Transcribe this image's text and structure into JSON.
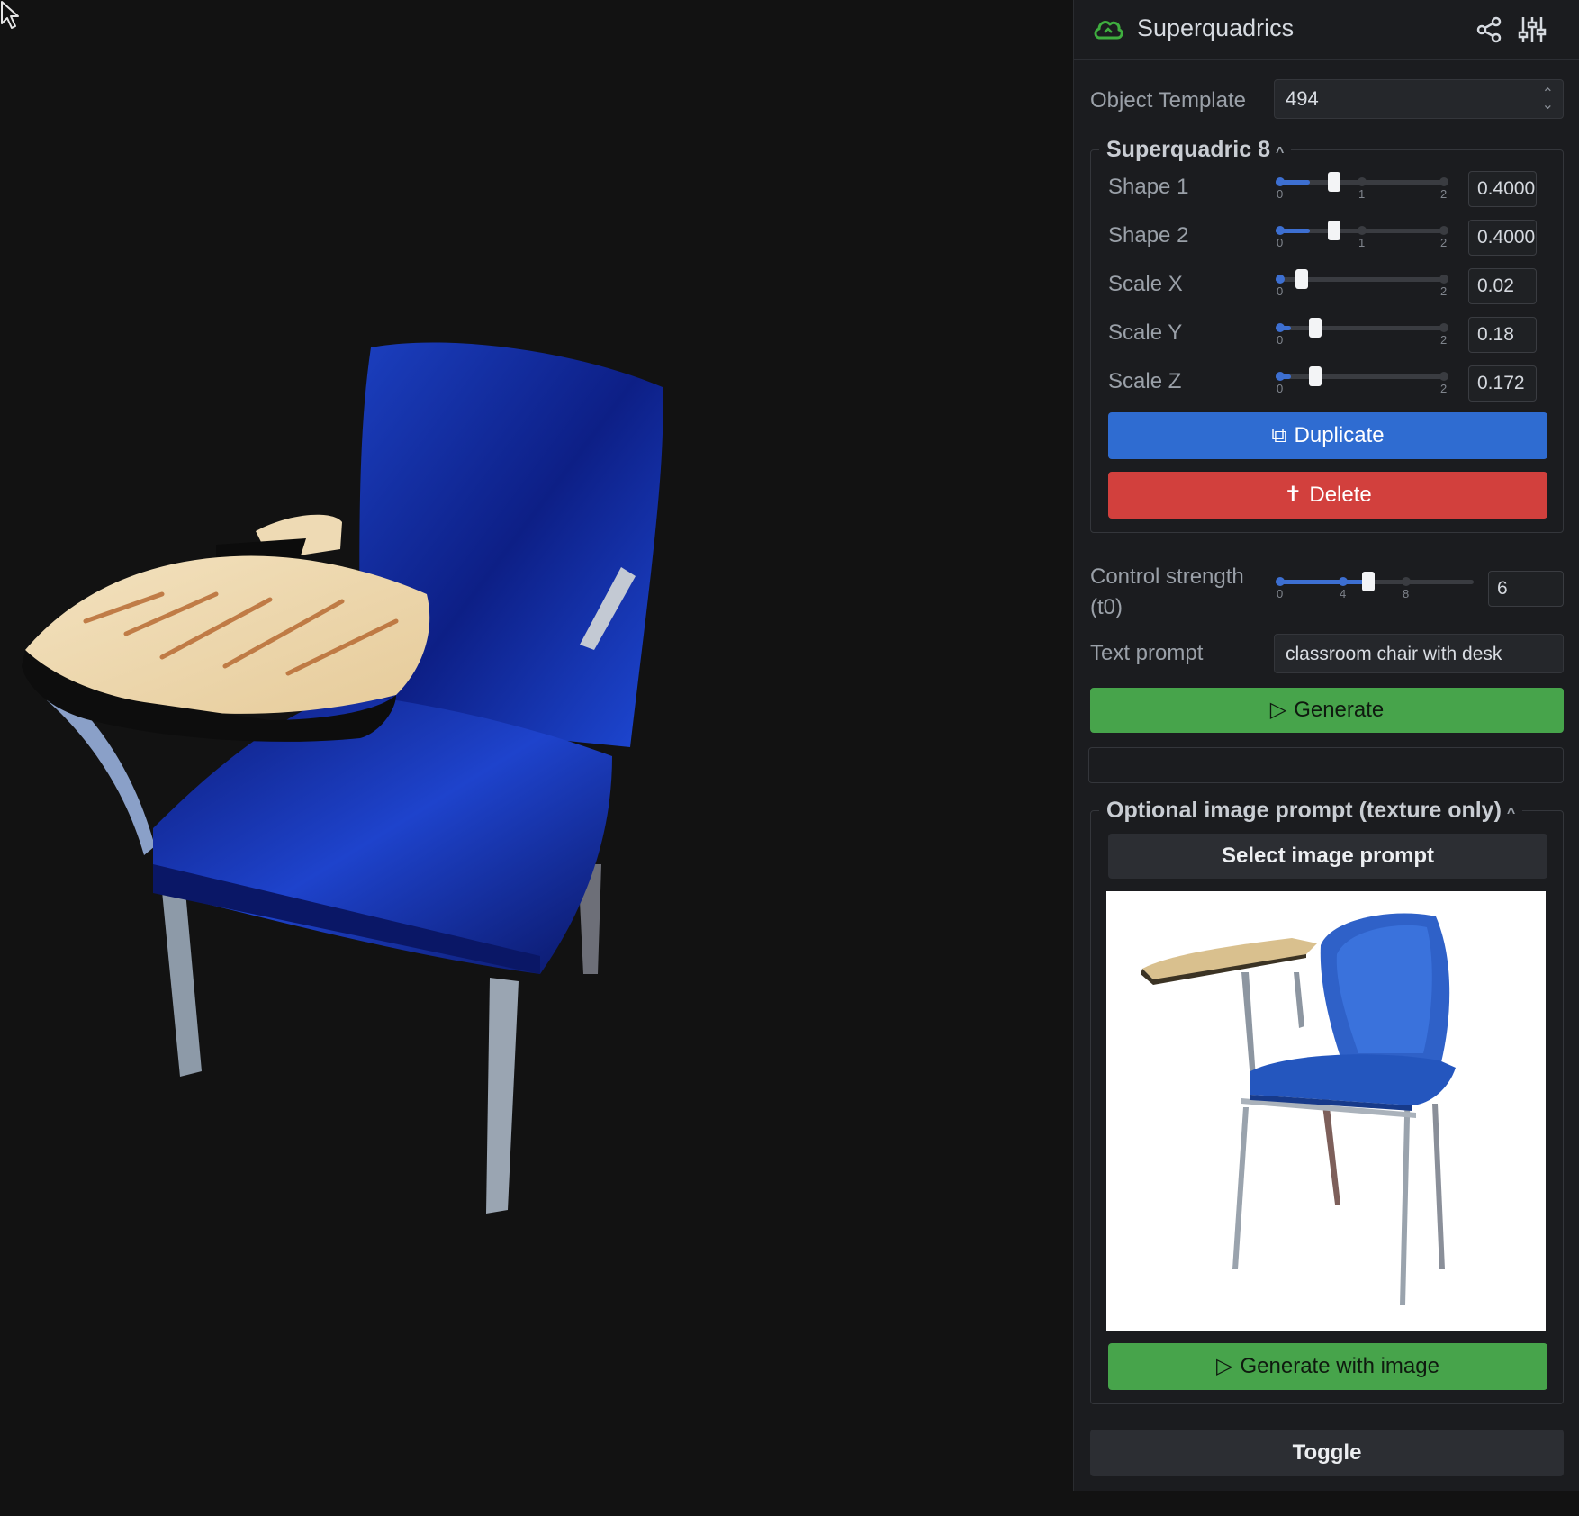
{
  "app": {
    "title": "Superquadrics"
  },
  "header_icons": [
    "share-icon",
    "settings-sliders-icon"
  ],
  "object_template": {
    "label": "Object Template",
    "value": "494"
  },
  "superquadric": {
    "title": "Superquadric 8",
    "sliders": [
      {
        "label": "Shape 1",
        "value": "0.4000",
        "fraction": 0.2,
        "ticks": [
          "0",
          "1",
          "2"
        ]
      },
      {
        "label": "Shape 2",
        "value": "0.4000",
        "fraction": 0.2,
        "ticks": [
          "0",
          "1",
          "2"
        ]
      },
      {
        "label": "Scale X",
        "value": "0.02",
        "fraction": 0.01,
        "ticks": [
          "0",
          "2"
        ]
      },
      {
        "label": "Scale Y",
        "value": "0.18",
        "fraction": 0.09,
        "ticks": [
          "0",
          "2"
        ]
      },
      {
        "label": "Scale Z",
        "value": "0.172",
        "fraction": 0.086,
        "ticks": [
          "0",
          "2"
        ]
      }
    ],
    "duplicate_label": "Duplicate",
    "delete_label": "Delete"
  },
  "control_strength": {
    "label_line1": "Control strength",
    "label_line2": "(t0)",
    "value": "6",
    "fraction": 0.5,
    "ticks": [
      "0",
      "4",
      "8"
    ]
  },
  "text_prompt": {
    "label": "Text prompt",
    "value": "classroom chair with desk"
  },
  "generate_label": "Generate",
  "image_prompt": {
    "title": "Optional image prompt (texture only)",
    "select_label": "Select image prompt",
    "generate_label": "Generate with image"
  },
  "toggle_label": "Toggle",
  "colors": {
    "accent_blue": "#2f6cd1",
    "danger_red": "#d2403d",
    "success_green": "#47a44b",
    "logo_green": "#3fae3f"
  }
}
